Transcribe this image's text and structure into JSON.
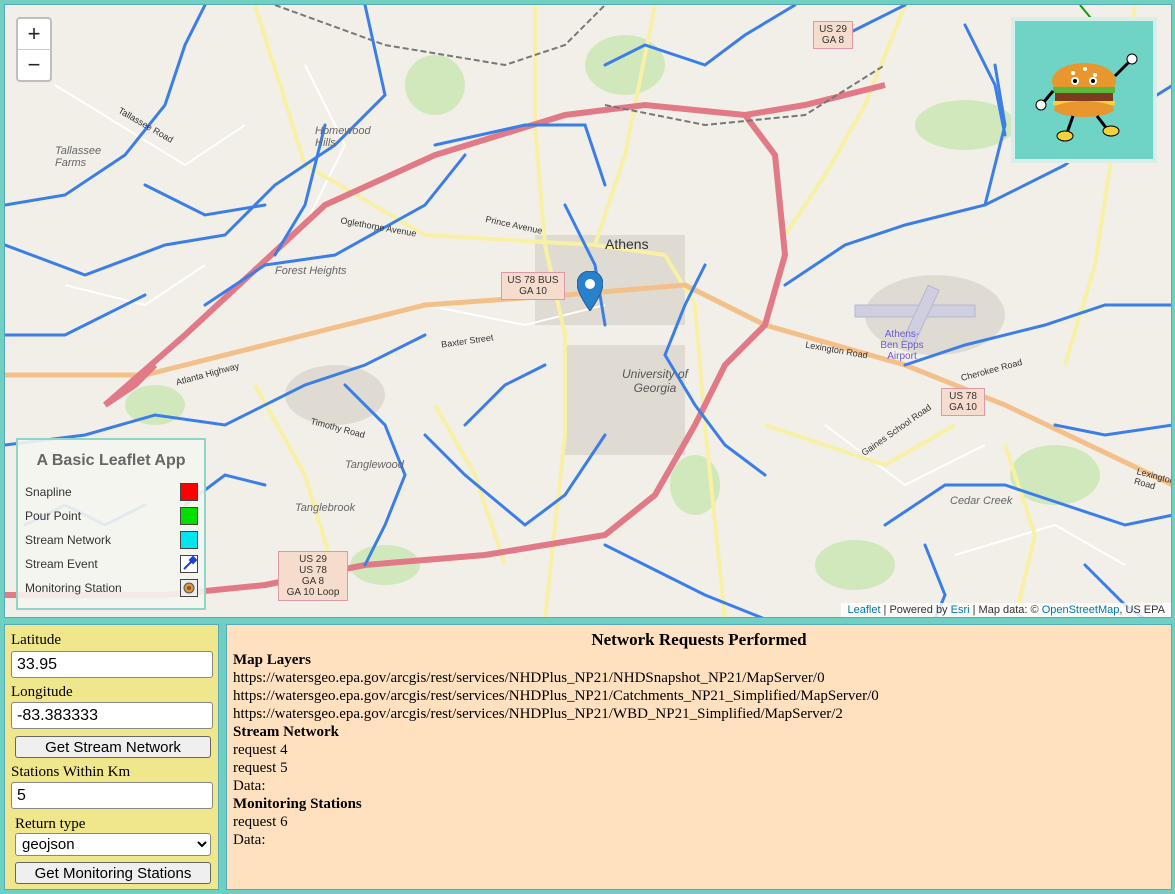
{
  "map": {
    "zoom_in": "+",
    "zoom_out": "−",
    "logo_icon": "burger-mascot-icon",
    "marker_icon": "map-pin-icon",
    "labels": {
      "athens": "Athens",
      "uga": "University of Georgia",
      "homewood": "Homewood Hills",
      "tallassee_farms": "Tallassee Farms",
      "forest_heights": "Forest Heights",
      "tanglewood": "Tanglewood",
      "tanglebrook": "Tanglebrook",
      "cedar_creek": "Cedar Creek",
      "airport": "Athens-Ben Epps Airport",
      "prince_ave": "Prince Avenue",
      "oglethorpe": "Oglethorpe Avenue",
      "baxter": "Baxter Street",
      "lexington": "Lexington Road",
      "atlanta_hwy": "Atlanta Highway",
      "timothy": "Timothy Road",
      "tallassee": "Tallassee Road",
      "gaines_school": "Gaines School Road",
      "cherokee_rd": "Cherokee Road"
    },
    "shields": {
      "us78bus": "US 78 BUS\nGA 10",
      "us29": "US 29\nGA 8",
      "us78": "US 78\nGA 10",
      "us29_south": "US 29\nUS 78\nGA 8\nGA 10 Loop"
    },
    "attribution": {
      "leaflet": "Leaflet",
      "powered": " | Powered by ",
      "esri": "Esri",
      "mapdata": " | Map data: © ",
      "osm": "OpenStreetMap",
      "epa": ", US EPA"
    }
  },
  "legend": {
    "title": "A Basic Leaflet App",
    "items": [
      {
        "label": "Snapline",
        "color": "#ff0000"
      },
      {
        "label": "Pour Point",
        "color": "#00e000"
      },
      {
        "label": "Stream Network",
        "color": "#00e5ee"
      },
      {
        "label": "Stream Event",
        "icon": "dropper-icon"
      },
      {
        "label": "Monitoring Station",
        "icon": "station-icon"
      }
    ]
  },
  "form": {
    "lat_label": "Latitude",
    "lat_value": "33.95",
    "lon_label": "Longitude",
    "lon_value": "-83.383333",
    "get_stream": "Get Stream Network",
    "stations_label": "Stations Within Km",
    "stations_value": "5",
    "return_label": "Return type",
    "return_value": "geojson",
    "get_stations": "Get Monitoring Stations"
  },
  "network": {
    "title": "Network Requests Performed",
    "map_layers_heading": "Map Layers",
    "map_layers": [
      "https://watersgeo.epa.gov/arcgis/rest/services/NHDPlus_NP21/NHDSnapshot_NP21/MapServer/0",
      "https://watersgeo.epa.gov/arcgis/rest/services/NHDPlus_NP21/Catchments_NP21_Simplified/MapServer/0",
      "https://watersgeo.epa.gov/arcgis/rest/services/NHDPlus_NP21/WBD_NP21_Simplified/MapServer/2"
    ],
    "stream_heading": "Stream Network",
    "stream_lines": [
      "request 4",
      "request 5",
      "Data:"
    ],
    "stations_heading": "Monitoring Stations",
    "stations_lines": [
      "request 6",
      "Data:"
    ]
  }
}
